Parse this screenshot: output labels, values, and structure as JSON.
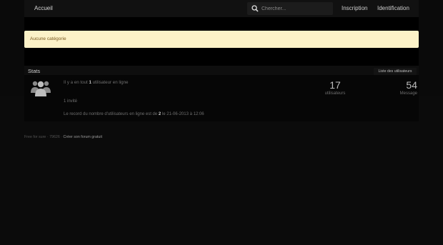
{
  "nav": {
    "home": "Accueil",
    "search_placeholder": "Chercher...",
    "register": "Inscription",
    "login": "Identification"
  },
  "notice": {
    "text": "Aucune catégorie"
  },
  "stats": {
    "title": "Stats",
    "user_list_button": "Liste des utilisateurs",
    "online_prefix": "Il y a en tout ",
    "online_count": "1",
    "online_suffix": " utilisateur en ligne",
    "visitors": "1 invité",
    "record_prefix": "Le record du nombre d'utilisateurs en ligne est de ",
    "record_count": "2",
    "record_suffix": " le 21-06-2013 à 12:06",
    "users_count": "17",
    "users_label": "utilisateurs",
    "messages_count": "54",
    "messages_label": "Message"
  },
  "footer": {
    "brand": "Free for sure",
    "sep1": "·",
    "id": "79626",
    "sep2": "·",
    "create": "Créer son forum gratuit"
  }
}
